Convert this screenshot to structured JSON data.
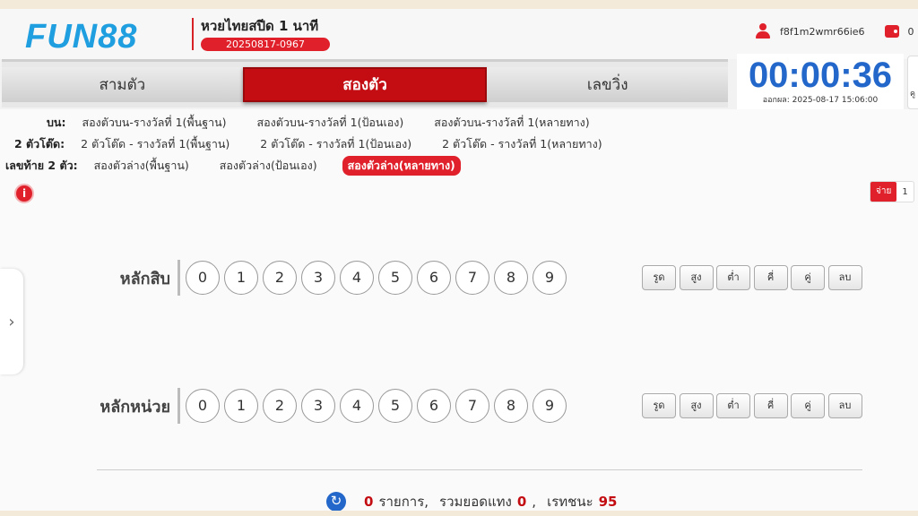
{
  "brand": {
    "logo_text": "FUN88",
    "accent": "#e0202a",
    "blue": "#2267c9"
  },
  "header": {
    "game_title": "หวยไทยสปีด 1 นาที",
    "round_id": "20250817-0967",
    "username": "f8f1m2wmr66ie6",
    "balance": "0",
    "user_icon": "user-icon",
    "wallet_icon": "wallet-icon"
  },
  "tabs": [
    {
      "label": "สามตัว",
      "active": false
    },
    {
      "label": "สองตัว",
      "active": true
    },
    {
      "label": "เลขวิ่ง",
      "active": false
    }
  ],
  "timer": {
    "countdown": "00:00:36",
    "draw_time": "ออกผล: 2025-08-17 15:06:00",
    "side_text": "คู"
  },
  "options": {
    "top": {
      "label": "บน:",
      "items": [
        "สองตัวบน-รางวัลที่ 1(พื้นฐาน)",
        "สองตัวบน-รางวัลที่ 1(ป้อนเอง)",
        "สองตัวบน-รางวัลที่ 1(หลายทาง)"
      ]
    },
    "tod": {
      "label": "2 ตัวโต๊ด:",
      "items": [
        "2 ตัวโต๊ด - รางวัลที่ 1(พื้นฐาน)",
        "2 ตัวโต๊ด - รางวัลที่ 1(ป้อนเอง)",
        "2 ตัวโต๊ด - รางวัลที่ 1(หลายทาง)"
      ]
    },
    "bottom": {
      "label": "เลขท้าย 2 ตัว:",
      "items": [
        "สองตัวล่าง(พื้นฐาน)",
        "สองตัวล่าง(ป้อนเอง)",
        "สองตัวล่าง(หลายทาง)"
      ],
      "active_index": 2
    }
  },
  "pay": {
    "label": "จ่าย",
    "value": "1"
  },
  "rows": [
    {
      "label": "หลักสิบ",
      "digits": [
        "0",
        "1",
        "2",
        "3",
        "4",
        "5",
        "6",
        "7",
        "8",
        "9"
      ]
    },
    {
      "label": "หลักหน่วย",
      "digits": [
        "0",
        "1",
        "2",
        "3",
        "4",
        "5",
        "6",
        "7",
        "8",
        "9"
      ]
    }
  ],
  "quick_buttons": [
    "รูด",
    "สูง",
    "ต่ำ",
    "คี่",
    "คู่",
    "ลบ"
  ],
  "summary": {
    "count": "0",
    "count_label": "รายการ,",
    "total_label": "รวมยอดแทง",
    "total": "0",
    "rate_sep": ",",
    "rate_label": "เรทชนะ",
    "rate": "95"
  }
}
